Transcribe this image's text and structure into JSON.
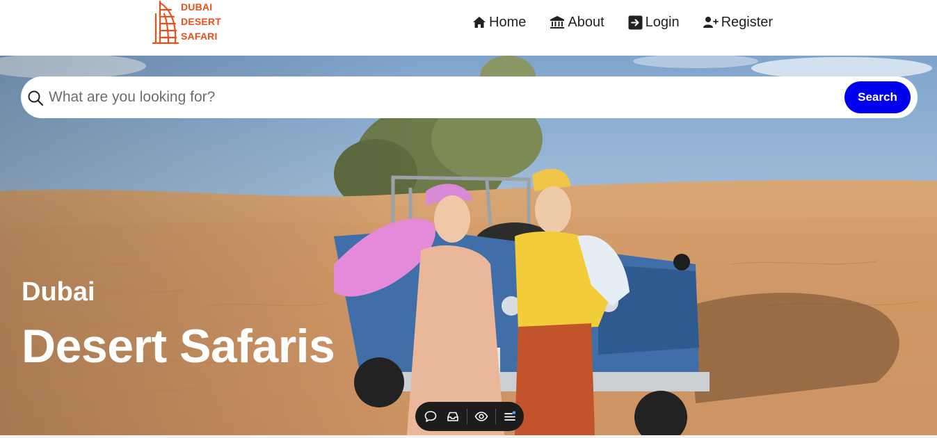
{
  "brand": {
    "line1": "DUBAI",
    "line2": "DESERT",
    "line3": "SAFARI",
    "color": "#e8501a",
    "icon": "burj-al-arab-icon"
  },
  "nav": {
    "home": "Home",
    "about": "About",
    "login": "Login",
    "register": "Register",
    "icons": [
      "home-icon",
      "institution-icon",
      "login-icon",
      "user-plus-icon"
    ]
  },
  "search": {
    "placeholder": "What are you looking for?",
    "button": "Search",
    "button_color": "#0000ee"
  },
  "hero": {
    "subtitle": "Dubai",
    "title": "Desert Safaris"
  },
  "toolbar": {
    "icons": [
      "comment-icon",
      "inbox-icon",
      "eye-icon",
      "menu-icon"
    ]
  }
}
